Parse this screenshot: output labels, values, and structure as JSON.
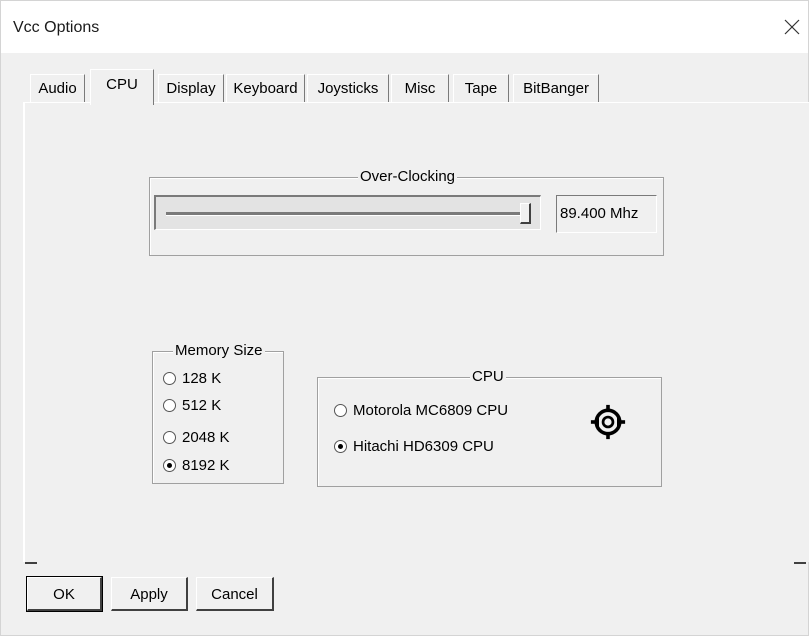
{
  "window": {
    "title": "Vcc Options",
    "close_icon": "close-icon"
  },
  "tabs": [
    {
      "label": "Audio",
      "active": false
    },
    {
      "label": "CPU",
      "active": true
    },
    {
      "label": "Display",
      "active": false
    },
    {
      "label": "Keyboard",
      "active": false
    },
    {
      "label": "Joysticks",
      "active": false
    },
    {
      "label": "Misc",
      "active": false
    },
    {
      "label": "Tape",
      "active": false
    },
    {
      "label": "BitBanger",
      "active": false
    }
  ],
  "overclocking": {
    "label": "Over-Clocking",
    "value_text": "89.400 Mhz",
    "slider_fraction": 0.98
  },
  "memory": {
    "label": "Memory Size",
    "options": [
      {
        "label": "128 K",
        "checked": false
      },
      {
        "label": "512 K",
        "checked": false
      },
      {
        "label": "2048 K",
        "checked": false
      },
      {
        "label": "8192 K",
        "checked": true
      }
    ]
  },
  "cpu": {
    "label": "CPU",
    "options": [
      {
        "label": "Motorola MC6809 CPU",
        "checked": false
      },
      {
        "label": "Hitachi HD6309 CPU",
        "checked": true
      }
    ],
    "logo_icon": "hitachi-logo-icon"
  },
  "buttons": {
    "ok": "OK",
    "apply": "Apply",
    "cancel": "Cancel"
  }
}
